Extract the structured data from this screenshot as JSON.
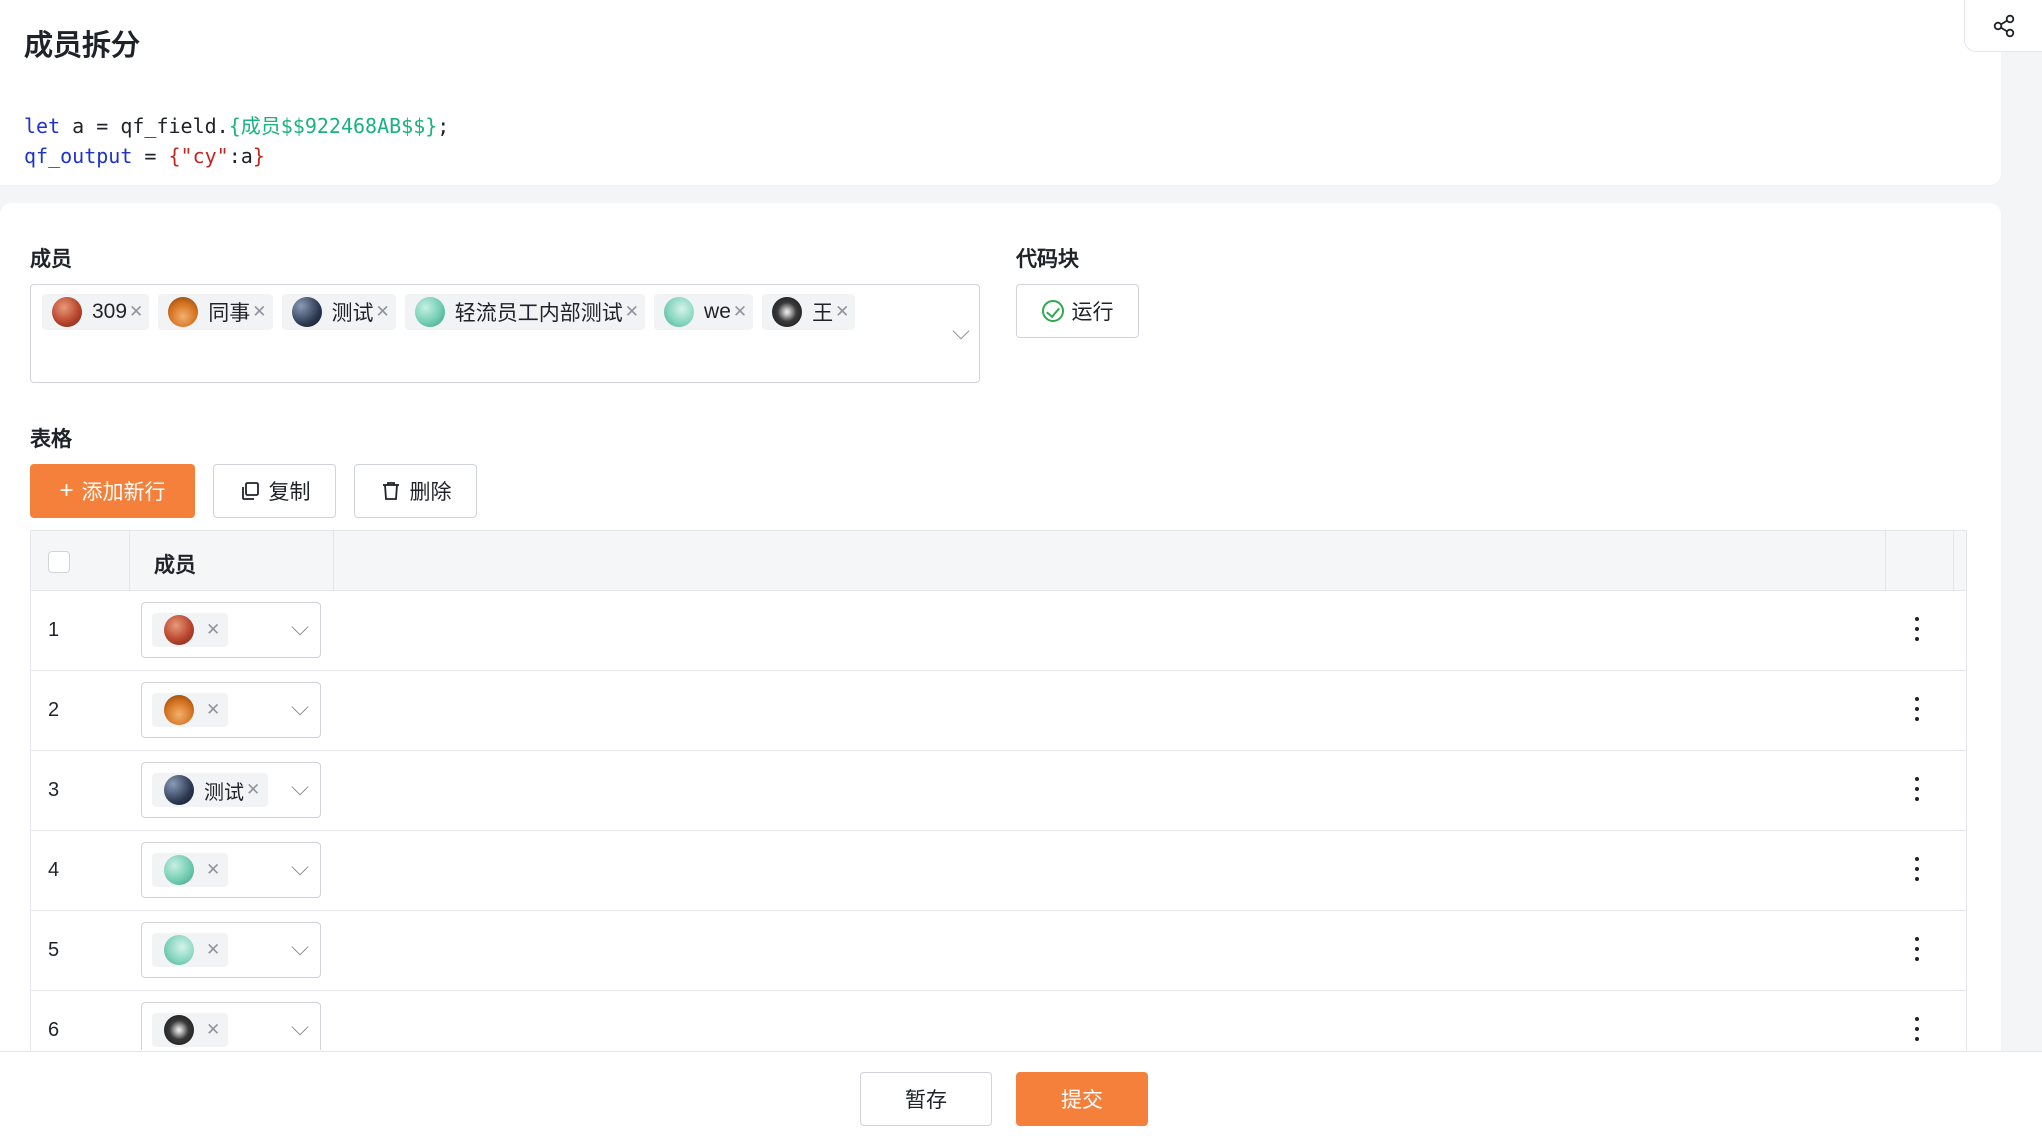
{
  "page": {
    "title": "成员拆分"
  },
  "code": {
    "line1": {
      "kw": "let",
      "rest": " a = qf_field.",
      "tpl": "{成员$$922468AB$$}",
      "end": ";"
    },
    "line2": {
      "var": "qf_output",
      "eq": " = ",
      "open": "{",
      "str": "\"cy\"",
      "rest": ":a",
      "close": "}"
    }
  },
  "form": {
    "member_label": "成员",
    "code_block_label": "代码块",
    "run_label": "运行",
    "selected_members": [
      {
        "name": "309",
        "avatar": "av-309"
      },
      {
        "name": "同事",
        "avatar": "av-tongshi"
      },
      {
        "name": "测试",
        "avatar": "av-ceshi"
      },
      {
        "name": "轻流员工内部测试",
        "avatar": "av-qing"
      },
      {
        "name": "we",
        "avatar": "av-we"
      },
      {
        "name": "王",
        "avatar": "av-wang"
      }
    ],
    "table_label": "表格"
  },
  "toolbar": {
    "add_row_label": "添加新行",
    "copy_label": "复制",
    "delete_label": "删除"
  },
  "table": {
    "header": {
      "member": "成员"
    },
    "rows": [
      {
        "num": "1",
        "text": "",
        "avatar": "av-309"
      },
      {
        "num": "2",
        "text": "",
        "avatar": "av-tongshi"
      },
      {
        "num": "3",
        "text": "测试",
        "avatar": "av-ceshi"
      },
      {
        "num": "4",
        "text": "",
        "avatar": "av-qing"
      },
      {
        "num": "5",
        "text": "",
        "avatar": "av-we"
      },
      {
        "num": "6",
        "text": "",
        "avatar": "av-wang"
      }
    ]
  },
  "footer": {
    "save_draft_label": "暂存",
    "submit_label": "提交"
  },
  "icons": {
    "share": "share-icon",
    "remove": "close-icon",
    "dropdown": "chevron-down-icon",
    "run": "check-circle-icon",
    "add": "plus-icon",
    "copy": "copy-icon",
    "delete": "trash-icon",
    "more": "more-vertical-icon"
  },
  "colors": {
    "accent": "#f5803c",
    "success": "#2fa84f",
    "keyword": "#1f33c8",
    "template": "#19b37e",
    "string": "#c0281f"
  }
}
